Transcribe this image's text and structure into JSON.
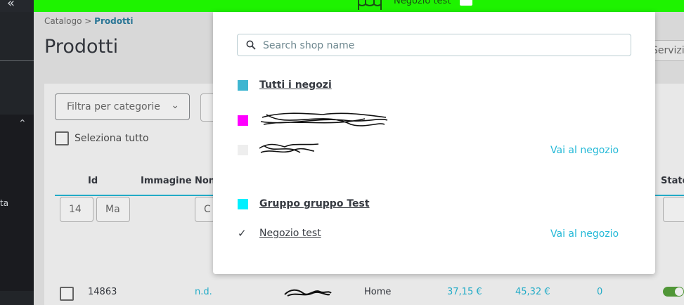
{
  "topbar": {
    "shop_label": "Negozio test",
    "accent": "#1ef300"
  },
  "breadcrumb": {
    "parent": "Catalogo",
    "separator": ">",
    "current": "Prodotti"
  },
  "page": {
    "title": "Prodotti",
    "services_button": "Servizi"
  },
  "sidebar": {
    "item_label": "ta"
  },
  "catalog": {
    "filter_button": "Filtra per categorie",
    "select_all": "Seleziona tutto",
    "columns": {
      "id": "Id",
      "image": "Immagine",
      "name": "Non",
      "status": "Stato"
    },
    "filters": {
      "id_min": "14",
      "id_max": "Ma",
      "name": "C"
    },
    "row": {
      "id": "14863",
      "image": "n.d.",
      "category": "Home",
      "price_ex": "37,15 €",
      "price_inc": "45,32 €",
      "quantity": "0",
      "active": true
    }
  },
  "shop_selector": {
    "search_placeholder": "Search shop name",
    "visit_label": "Vai al negozio",
    "items": [
      {
        "label": "Tutti i negozi",
        "color": "#3fb6d1",
        "kind": "all"
      },
      {
        "label": "",
        "color": "#ff00ff",
        "kind": "group",
        "redacted": true
      },
      {
        "label": "",
        "color": "#eeeeee",
        "kind": "shop",
        "redacted": true
      },
      {
        "label": "Gruppo gruppo Test",
        "color": "#00f0ff",
        "kind": "group"
      },
      {
        "label": "Negozio test",
        "kind": "shop",
        "selected": true
      }
    ]
  }
}
